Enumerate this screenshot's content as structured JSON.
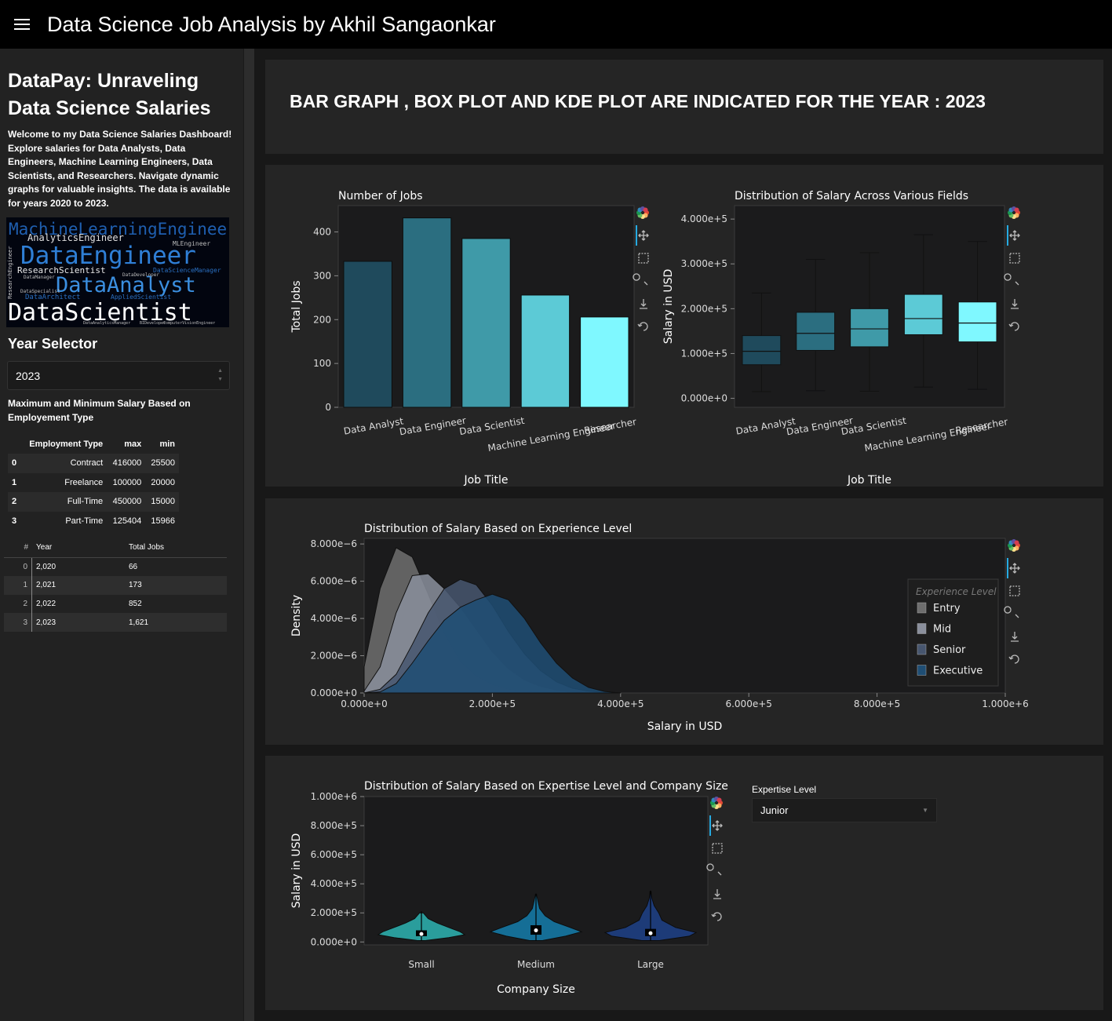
{
  "header": {
    "title": "Data Science Job Analysis by Akhil Sangaonkar"
  },
  "sidebar": {
    "title": "DataPay: Unraveling Data Science Salaries",
    "description": "Welcome to my Data Science Salaries Dashboard! Explore salaries for Data Analysts, Data Engineers, Machine Learning Engineers, Data Scientists, and Researchers. Navigate dynamic graphs for valuable insights. The data is available for years 2020 to 2023.",
    "wordcloud": [
      "MachineLearningEngineer",
      "AnalyticsEngineer",
      "MLEngineer",
      "DataEngineer",
      "ResearchScientist",
      "DataScienceManager",
      "DataAnalyst",
      "ResearchEngineer",
      "DataArchitect",
      "AppliedScientist",
      "DataScientist",
      "DataManager",
      "DataSpecialist",
      "DataDeveloper",
      "BIDeveloper",
      "DataAnalyticsManager",
      "ComputerVisionEngineer"
    ],
    "year_selector": {
      "label": "Year Selector",
      "value": "2023"
    },
    "minmax_title": "Maximum and Minimum Salary Based on Employement Type",
    "emp_table": {
      "headers": [
        "",
        "Employment Type",
        "max",
        "min"
      ],
      "rows": [
        [
          "0",
          "Contract",
          "416000",
          "25500"
        ],
        [
          "1",
          "Freelance",
          "100000",
          "20000"
        ],
        [
          "2",
          "Full-Time",
          "450000",
          "15000"
        ],
        [
          "3",
          "Part-Time",
          "125404",
          "15966"
        ]
      ]
    },
    "years_table": {
      "headers": [
        "#",
        "Year",
        "Total Jobs"
      ],
      "rows": [
        [
          "0",
          "2,020",
          "66"
        ],
        [
          "1",
          "2,021",
          "173"
        ],
        [
          "2",
          "2,022",
          "852"
        ],
        [
          "3",
          "2,023",
          "1,621"
        ]
      ]
    }
  },
  "banner": {
    "text": "BAR GRAPH , BOX PLOT AND KDE PLOT ARE INDICATED FOR THE YEAR : 2023"
  },
  "expertise": {
    "label": "Expertise Level",
    "value": "Junior"
  },
  "icon_colors": [
    "#e34a33",
    "#fdae61",
    "#fee08b",
    "#66bd63",
    "#1a9850",
    "#3288bd",
    "#5e4fa2",
    "#d53e4f"
  ],
  "chart_data": [
    {
      "type": "bar",
      "title": "Number of Jobs",
      "xlabel": "Job Title",
      "ylabel": "Total Jobs",
      "categories": [
        "Data Analyst",
        "Data Engineer",
        "Data Scientist",
        "Machine Learning Engineer",
        "Researcher"
      ],
      "values": [
        333,
        432,
        385,
        256,
        206
      ],
      "colors": [
        "#1f4a5c",
        "#2b6e80",
        "#3f9aa8",
        "#5ccad6",
        "#7ff8ff"
      ],
      "ylim": [
        0,
        460
      ],
      "yticks": [
        0,
        100,
        200,
        300,
        400
      ],
      "grid": false
    },
    {
      "type": "box",
      "title": "Distribution of Salary Across Various Fields",
      "xlabel": "Job Title",
      "ylabel": "Salary in USD",
      "categories": [
        "Data Analyst",
        "Data Engineer",
        "Data Scientist",
        "Machine Learning Engineer",
        "Researcher"
      ],
      "boxes": [
        {
          "min": 15000,
          "q1": 75000,
          "median": 105000,
          "q3": 140000,
          "max": 235000
        },
        {
          "min": 17000,
          "q1": 107000,
          "median": 145000,
          "q3": 192000,
          "max": 310000
        },
        {
          "min": 16000,
          "q1": 115000,
          "median": 155000,
          "q3": 200000,
          "max": 325000
        },
        {
          "min": 25000,
          "q1": 142000,
          "median": 178000,
          "q3": 232000,
          "max": 365000
        },
        {
          "min": 20000,
          "q1": 126000,
          "median": 168000,
          "q3": 215000,
          "max": 350000
        }
      ],
      "colors": [
        "#1f4a5c",
        "#2b6e80",
        "#3f9aa8",
        "#5ccad6",
        "#7ff8ff"
      ],
      "ylim": [
        -20000,
        430000
      ],
      "ytick_values": [
        0,
        100000,
        200000,
        300000,
        400000
      ],
      "ytick_labels": [
        "0.000e+0",
        "1.000e+5",
        "2.000e+5",
        "3.000e+5",
        "4.000e+5"
      ]
    },
    {
      "type": "area",
      "title": "Distribution of Salary Based on Experience Level",
      "xlabel": "Salary in USD",
      "ylabel": "Density",
      "legend_title": "Experience Level",
      "legend_position": "right",
      "x": [
        0,
        25000,
        50000,
        75000,
        100000,
        125000,
        150000,
        175000,
        200000,
        225000,
        250000,
        275000,
        300000,
        325000,
        350000,
        375000,
        400000
      ],
      "series": [
        {
          "name": "Entry",
          "color": "#6e6e6e",
          "values": [
            1.4e-06,
            5.6e-06,
            7.8e-06,
            7.3e-06,
            5.3e-06,
            3.2e-06,
            1.7e-06,
            9e-07,
            4.5e-07,
            2e-07,
            8e-08,
            3e-08,
            1e-08,
            0,
            0,
            0,
            0
          ]
        },
        {
          "name": "Mid",
          "color": "#8a8f9c",
          "values": [
            1e-07,
            1.4e-06,
            4.3e-06,
            6.3e-06,
            6.4e-06,
            5.6e-06,
            4.6e-06,
            3.4e-06,
            2.2e-06,
            1.3e-06,
            7e-07,
            3.5e-07,
            1.5e-07,
            5e-08,
            2e-08,
            0,
            0
          ]
        },
        {
          "name": "Senior",
          "color": "#47566f",
          "values": [
            0,
            2e-07,
            1e-06,
            2.6e-06,
            4.3e-06,
            5.6e-06,
            6.1e-06,
            5.8e-06,
            4.7e-06,
            3.3e-06,
            2.1e-06,
            1.2e-06,
            6e-07,
            2.5e-07,
            1e-07,
            3e-08,
            0
          ]
        },
        {
          "name": "Executive",
          "color": "#1f4e74",
          "values": [
            0,
            5e-08,
            5e-07,
            1.6e-06,
            2.8e-06,
            3.9e-06,
            4.6e-06,
            5e-06,
            5.3e-06,
            5e-06,
            4e-06,
            2.7e-06,
            1.6e-06,
            8e-07,
            3e-07,
            8e-08,
            0
          ]
        }
      ],
      "xlim": [
        0,
        1000000
      ],
      "xtick_values": [
        0,
        200000,
        400000,
        600000,
        800000,
        1000000
      ],
      "xtick_labels": [
        "0.000e+0",
        "2.000e+5",
        "4.000e+5",
        "6.000e+5",
        "8.000e+5",
        "1.000e+6"
      ],
      "ylim": [
        0,
        8.3e-06
      ],
      "ytick_values": [
        0,
        2e-06,
        4e-06,
        6e-06,
        8e-06
      ],
      "ytick_labels": [
        "0.000e+0",
        "2.000e−6",
        "4.000e−6",
        "6.000e−6",
        "8.000e−6"
      ]
    },
    {
      "type": "violin",
      "title": "Distribution of Salary Based on Expertise Level and Company Size",
      "xlabel": "Company Size",
      "ylabel": "Salary in USD",
      "categories": [
        "Small",
        "Medium",
        "Large"
      ],
      "colors": [
        "#2a9d9c",
        "#156e96",
        "#1d3b78"
      ],
      "profiles": [
        [
          [
            10000,
            0.1
          ],
          [
            30000,
            0.6
          ],
          [
            50000,
            0.95
          ],
          [
            70000,
            0.85
          ],
          [
            100000,
            0.6
          ],
          [
            130000,
            0.35
          ],
          [
            160000,
            0.15
          ],
          [
            200000,
            0.04
          ]
        ],
        [
          [
            10000,
            0.15
          ],
          [
            40000,
            0.65
          ],
          [
            70000,
            1.0
          ],
          [
            100000,
            0.75
          ],
          [
            140000,
            0.4
          ],
          [
            180000,
            0.2
          ],
          [
            230000,
            0.08
          ],
          [
            300000,
            0.03
          ],
          [
            330000,
            0.01
          ]
        ],
        [
          [
            10000,
            0.2
          ],
          [
            40000,
            0.85
          ],
          [
            65000,
            1.0
          ],
          [
            100000,
            0.55
          ],
          [
            150000,
            0.25
          ],
          [
            200000,
            0.18
          ],
          [
            250000,
            0.08
          ],
          [
            300000,
            0.03
          ],
          [
            350000,
            0.01
          ]
        ]
      ],
      "boxes": [
        {
          "q1": 40000,
          "median": 55000,
          "q3": 80000,
          "low": 10000,
          "high": 210000
        },
        {
          "q1": 50000,
          "median": 80000,
          "q3": 115000,
          "low": 10000,
          "high": 330000
        },
        {
          "q1": 40000,
          "median": 60000,
          "q3": 90000,
          "low": 10000,
          "high": 350000
        }
      ],
      "ylim": [
        -20000,
        1000000
      ],
      "ytick_values": [
        0,
        200000,
        400000,
        600000,
        800000,
        1000000
      ],
      "ytick_labels": [
        "0.000e+0",
        "2.000e+5",
        "4.000e+5",
        "6.000e+5",
        "8.000e+5",
        "1.000e+6"
      ]
    }
  ]
}
